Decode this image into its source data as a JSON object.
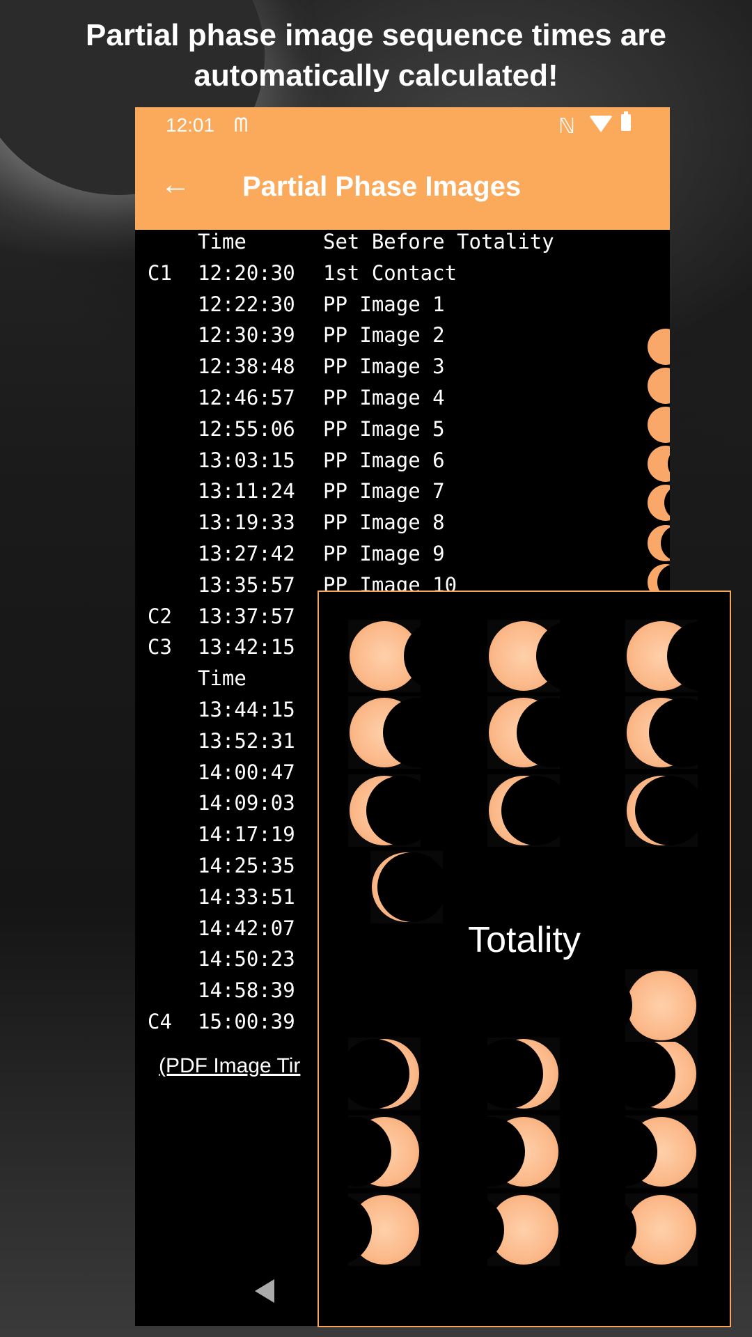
{
  "headline": {
    "line1": "Partial phase image sequence times are",
    "line2": "automatically calculated!"
  },
  "statusbar": {
    "time": "12:01",
    "icons": [
      "gmail-icon",
      "nfc-icon",
      "wifi-icon",
      "battery-icon"
    ]
  },
  "appbar": {
    "back_icon": "arrow-left-icon",
    "title": "Partial Phase Images"
  },
  "table": {
    "header1": {
      "time": "Time",
      "desc": "Set Before Totality"
    },
    "rows_before": [
      {
        "contact": "C1",
        "time": "12:20:30",
        "desc": "1st Contact"
      },
      {
        "contact": "",
        "time": "12:22:30",
        "desc": "PP Image 1"
      },
      {
        "contact": "",
        "time": "12:30:39",
        "desc": "PP Image 2"
      },
      {
        "contact": "",
        "time": "12:38:48",
        "desc": "PP Image 3"
      },
      {
        "contact": "",
        "time": "12:46:57",
        "desc": "PP Image 4"
      },
      {
        "contact": "",
        "time": "12:55:06",
        "desc": "PP Image 5"
      },
      {
        "contact": "",
        "time": "13:03:15",
        "desc": "PP Image 6"
      },
      {
        "contact": "",
        "time": "13:11:24",
        "desc": "PP Image 7"
      },
      {
        "contact": "",
        "time": "13:19:33",
        "desc": "PP Image 8"
      },
      {
        "contact": "",
        "time": "13:27:42",
        "desc": "PP Image 9"
      },
      {
        "contact": "",
        "time": "13:35:57",
        "desc": "PP Image 10"
      },
      {
        "contact": "C2",
        "time": "13:37:57",
        "desc": ""
      },
      {
        "contact": "C3",
        "time": "13:42:15",
        "desc": ""
      }
    ],
    "header2": {
      "time": "Time"
    },
    "rows_after": [
      {
        "contact": "",
        "time": "13:44:15"
      },
      {
        "contact": "",
        "time": "13:52:31"
      },
      {
        "contact": "",
        "time": "14:00:47"
      },
      {
        "contact": "",
        "time": "14:09:03"
      },
      {
        "contact": "",
        "time": "14:17:19"
      },
      {
        "contact": "",
        "time": "14:25:35"
      },
      {
        "contact": "",
        "time": "14:33:51"
      },
      {
        "contact": "",
        "time": "14:42:07"
      },
      {
        "contact": "",
        "time": "14:50:23"
      },
      {
        "contact": "",
        "time": "14:58:39"
      },
      {
        "contact": "C4",
        "time": "15:00:39"
      }
    ]
  },
  "pdf_link": "(PDF Image Tir",
  "overlay": {
    "totality_label": "Totality"
  },
  "colors": {
    "accent": "#fba95a",
    "sun": "#fbb98a",
    "overlay_border": "#f6a65c"
  }
}
